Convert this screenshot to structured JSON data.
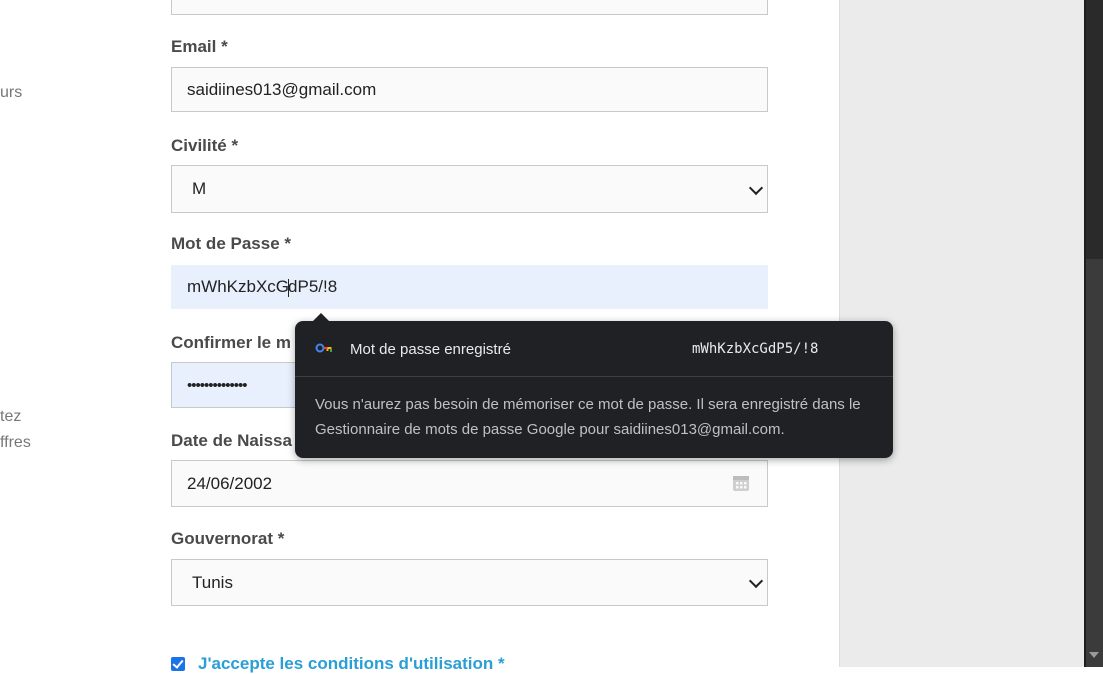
{
  "side_texts": {
    "line1": "urs",
    "line2": "tez",
    "line3": "ffres"
  },
  "form": {
    "email": {
      "label": "Email *",
      "value": "saidiines013@gmail.com"
    },
    "civilite": {
      "label": "Civilité *",
      "value": "M"
    },
    "password": {
      "label": "Mot de Passe *",
      "value_before_caret": "mWhKzbXcG",
      "value_after_caret": "dP5/!8"
    },
    "confirm": {
      "label": "Confirmer le m",
      "value": "••••••••••••••"
    },
    "birthdate": {
      "label": "Date de Naissa",
      "value": "24/06/2002"
    },
    "gouvernorat": {
      "label": "Gouvernorat *",
      "value": "Tunis"
    },
    "terms": {
      "label": "J'accepte les conditions d'utilisation *",
      "checked": true
    }
  },
  "popup": {
    "title": "Mot de passe enregistré",
    "password": "mWhKzbXcGdP5/!8",
    "description": "Vous n'aurez pas besoin de mémoriser ce mot de passe. Il sera enregistré dans le Gestionnaire de mots de passe Google pour saidiines013@gmail.com."
  },
  "colors": {
    "accent_link": "#2a9fd6",
    "autofill_bg": "#e8f0fe",
    "popup_bg": "#202124"
  }
}
